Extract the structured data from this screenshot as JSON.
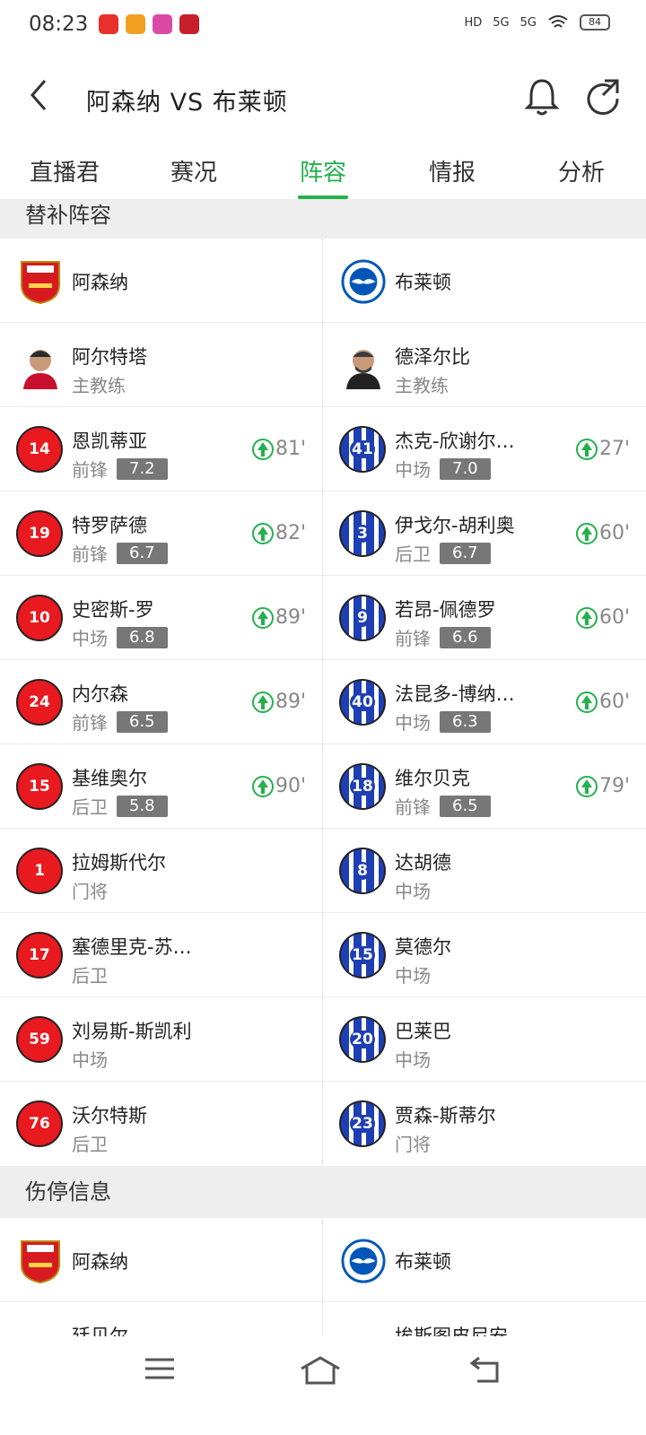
{
  "status": {
    "time": "08:23",
    "battery": "84",
    "net1": "5G",
    "net2": "5G",
    "hd": "HD"
  },
  "header": {
    "title": "阿森纳 VS 布莱顿"
  },
  "tabs": [
    "直播君",
    "赛况",
    "阵容",
    "情报",
    "分析"
  ],
  "active_tab": "阵容",
  "subs": {
    "section_title": "替补阵容",
    "home_team": "阿森纳",
    "away_team": "布莱顿",
    "home_coach": {
      "name": "阿尔特塔",
      "role": "主教练"
    },
    "away_coach": {
      "name": "德泽尔比",
      "role": "主教练"
    },
    "home": [
      {
        "num": "14",
        "name": "恩凯蒂亚",
        "pos": "前锋",
        "rating": "7.2",
        "minute": "81'"
      },
      {
        "num": "19",
        "name": "特罗萨德",
        "pos": "前锋",
        "rating": "6.7",
        "minute": "82'"
      },
      {
        "num": "10",
        "name": "史密斯-罗",
        "pos": "中场",
        "rating": "6.8",
        "minute": "89'"
      },
      {
        "num": "24",
        "name": "内尔森",
        "pos": "前锋",
        "rating": "6.5",
        "minute": "89'"
      },
      {
        "num": "15",
        "name": "基维奥尔",
        "pos": "后卫",
        "rating": "5.8",
        "minute": "90'"
      },
      {
        "num": "1",
        "name": "拉姆斯代尔",
        "pos": "门将"
      },
      {
        "num": "17",
        "name": "塞德里克-苏…",
        "pos": "后卫"
      },
      {
        "num": "59",
        "name": "刘易斯-斯凯利",
        "pos": "中场"
      },
      {
        "num": "76",
        "name": "沃尔特斯",
        "pos": "后卫"
      }
    ],
    "away": [
      {
        "num": "41",
        "name": "杰克-欣谢尔…",
        "pos": "中场",
        "rating": "7.0",
        "minute": "27'"
      },
      {
        "num": "3",
        "name": "伊戈尔-胡利奥",
        "pos": "后卫",
        "rating": "6.7",
        "minute": "60'"
      },
      {
        "num": "9",
        "name": "若昂-佩德罗",
        "pos": "前锋",
        "rating": "6.6",
        "minute": "60'"
      },
      {
        "num": "40",
        "name": "法昆多-博纳…",
        "pos": "中场",
        "rating": "6.3",
        "minute": "60'"
      },
      {
        "num": "18",
        "name": "维尔贝克",
        "pos": "前锋",
        "rating": "6.5",
        "minute": "79'"
      },
      {
        "num": "8",
        "name": "达胡德",
        "pos": "中场"
      },
      {
        "num": "15",
        "name": "莫德尔",
        "pos": "中场"
      },
      {
        "num": "20",
        "name": "巴莱巴",
        "pos": "中场"
      },
      {
        "num": "23",
        "name": "贾森-斯蒂尔",
        "pos": "门将"
      }
    ]
  },
  "injuries": {
    "section_title": "伤停信息",
    "home_team": "阿森纳",
    "away_team": "布莱顿",
    "home_partial": "廷贝尔",
    "away_partial": "埃斯图皮尼安"
  },
  "colors": {
    "accent": "#22b14c",
    "home": "#e8191f",
    "away": "#1e3fb4"
  }
}
